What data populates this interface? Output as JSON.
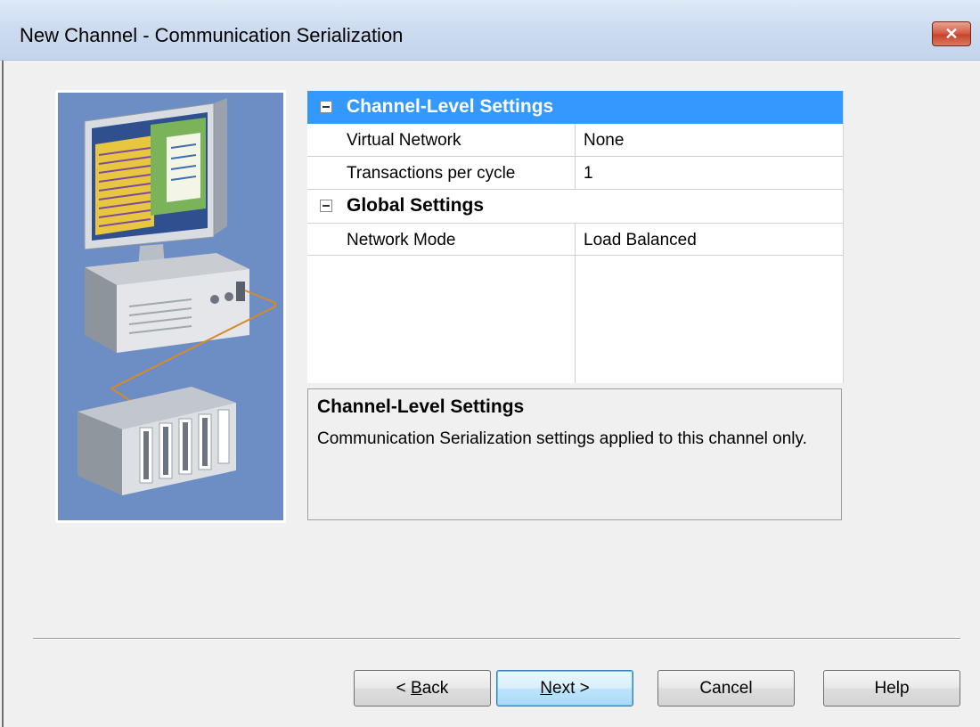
{
  "window": {
    "title": "New Channel - Communication Serialization",
    "close_glyph": "✕"
  },
  "illustration": {
    "icon": "computer-and-controller-icon",
    "background_color": "#6d8ec4"
  },
  "property_grid": {
    "categories": [
      {
        "label": "Channel-Level Settings",
        "selected": true,
        "properties": [
          {
            "name": "Virtual Network",
            "value": "None"
          },
          {
            "name": "Transactions per cycle",
            "value": "1"
          }
        ]
      },
      {
        "label": "Global Settings",
        "selected": false,
        "properties": [
          {
            "name": "Network Mode",
            "value": "Load Balanced"
          }
        ]
      }
    ]
  },
  "description": {
    "title": "Channel-Level Settings",
    "text": "Communication Serialization settings applied to this channel only."
  },
  "buttons": {
    "back": {
      "prefix": "< ",
      "mnemonic": "B",
      "rest": "ack"
    },
    "next": {
      "mnemonic": "N",
      "rest": "ext >"
    },
    "cancel": "Cancel",
    "help": "Help"
  },
  "colors": {
    "selection": "#3399ff",
    "dialog_background": "#f0f0f0"
  }
}
